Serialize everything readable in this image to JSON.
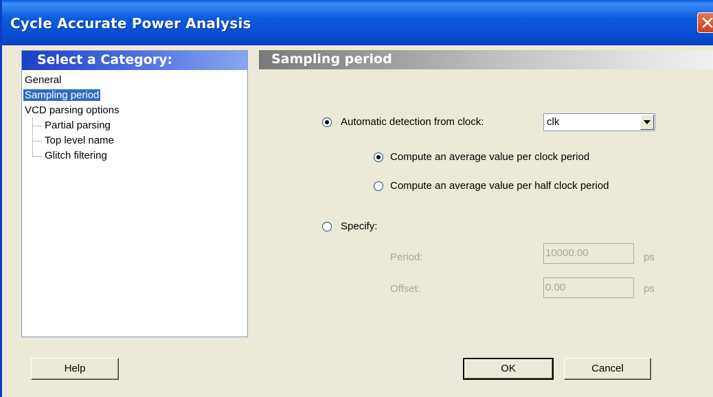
{
  "window": {
    "title": "Cycle Accurate Power Analysis"
  },
  "category_panel": {
    "header": "Select a Category:",
    "items": [
      {
        "label": "General",
        "level": 0,
        "selected": false
      },
      {
        "label": "Sampling period",
        "level": 0,
        "selected": true
      },
      {
        "label": "VCD parsing options",
        "level": 0,
        "selected": false
      },
      {
        "label": "Partial parsing",
        "level": 1,
        "selected": false
      },
      {
        "label": "Top level name",
        "level": 1,
        "selected": false
      },
      {
        "label": "Glitch filtering",
        "level": 1,
        "selected": false
      }
    ]
  },
  "sampling": {
    "header": "Sampling period",
    "auto_label": "Automatic detection from clock:",
    "clock_value": "clk",
    "avg_full_label": "Compute an average value per clock period",
    "avg_half_label": "Compute an average value per half clock period",
    "specify_label": "Specify:",
    "period_label": "Period:",
    "period_value": "10000.00",
    "period_unit": "ps",
    "offset_label": "Offset:",
    "offset_value": "0.00",
    "offset_unit": "ps"
  },
  "buttons": {
    "help": "Help",
    "ok": "OK",
    "cancel": "Cancel"
  },
  "icons": {
    "close": "close-icon",
    "dropdown": "chevron-down-icon"
  },
  "colors": {
    "title_bar": "#0a5ee0",
    "selection": "#316ac5",
    "dialog_bg": "#ece9d8"
  }
}
